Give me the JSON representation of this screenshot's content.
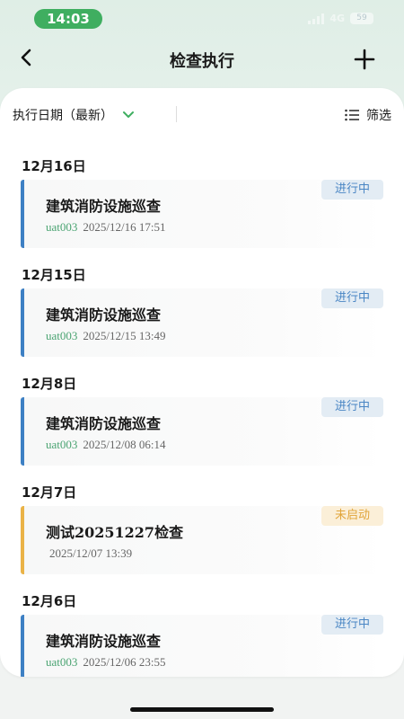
{
  "status": {
    "time": "14:03",
    "network": "4G",
    "battery": "59"
  },
  "nav": {
    "title": "检查执行"
  },
  "filter": {
    "sort_label": "执行日期（最新）",
    "filter_label": "筛选"
  },
  "groups": [
    {
      "date": "12月16日",
      "title": "建筑消防设施巡查",
      "user": "uat003",
      "datetime": "2025/12/16 17:51",
      "status": "进行中"
    },
    {
      "date": "12月15日",
      "title": "建筑消防设施巡查",
      "user": "uat003",
      "datetime": "2025/12/15 13:49",
      "status": "进行中"
    },
    {
      "date": "12月8日",
      "title": "建筑消防设施巡查",
      "user": "uat003",
      "datetime": "2025/12/08 06:14",
      "status": "进行中"
    },
    {
      "date": "12月7日",
      "title": "测试20251227检查",
      "user": "",
      "datetime": "2025/12/07 13:39",
      "status": "未启动"
    },
    {
      "date": "12月6日",
      "title": "建筑消防设施巡查",
      "user": "uat003",
      "datetime": "2025/12/06 23:55",
      "status": "进行中"
    }
  ],
  "colors": {
    "accent_green": "#3fae60",
    "in_progress": "#3d80c4",
    "not_started": "#eab347"
  }
}
